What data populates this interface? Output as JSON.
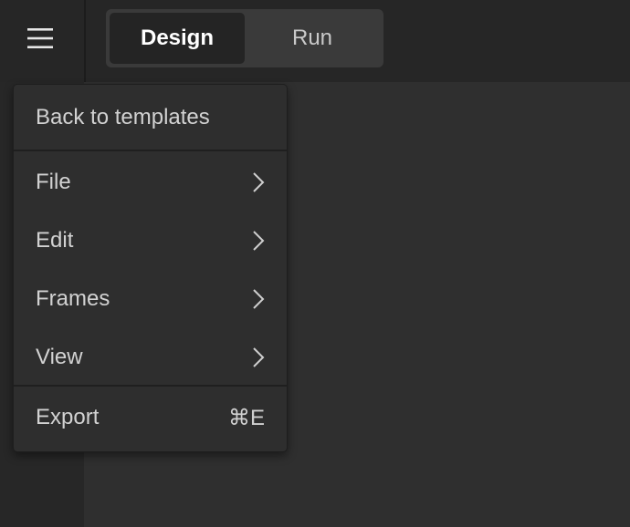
{
  "toolbar": {
    "menu_icon": "hamburger-icon",
    "modes": [
      {
        "label": "Design",
        "active": true
      },
      {
        "label": "Run",
        "active": false
      }
    ]
  },
  "menu": {
    "back_label": "Back to templates",
    "items": [
      {
        "label": "File",
        "icon": "chevron-right-icon"
      },
      {
        "label": "Edit",
        "icon": "chevron-right-icon"
      },
      {
        "label": "Frames",
        "icon": "chevron-right-icon"
      },
      {
        "label": "View",
        "icon": "chevron-right-icon"
      }
    ],
    "export": {
      "label": "Export",
      "shortcut": "⌘E"
    }
  },
  "colors": {
    "background": "#2f2f2f",
    "topbar": "#262626",
    "menu_bg": "#2e2e2e",
    "text": "#d2d2d2",
    "active_tab_bg": "#242424"
  }
}
